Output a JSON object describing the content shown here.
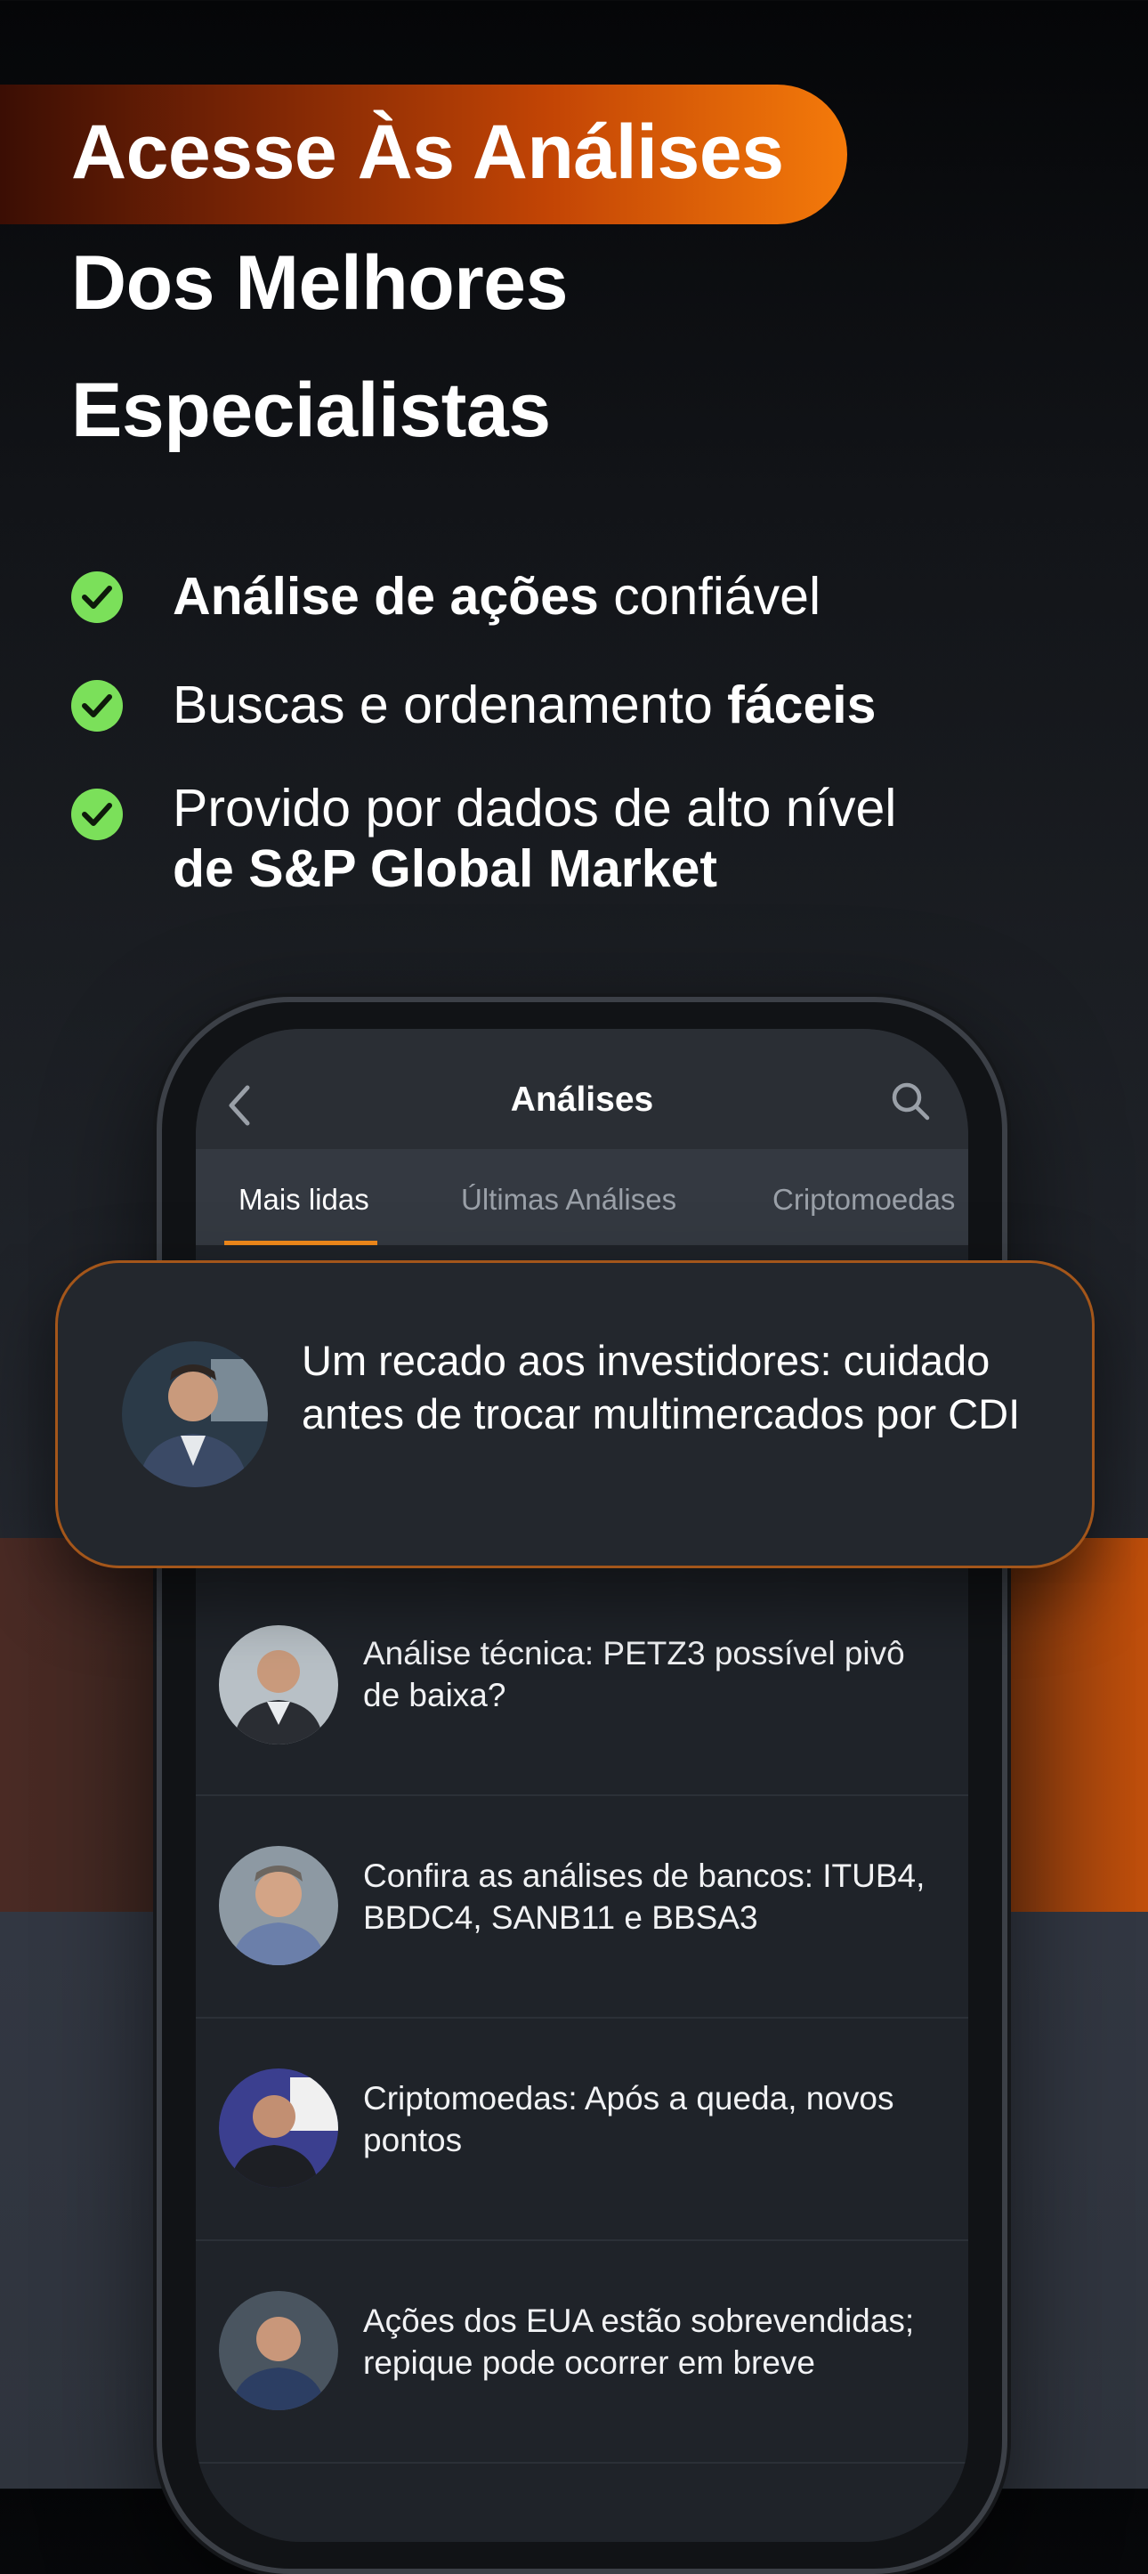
{
  "headline": {
    "line1": "Acesse Às Análises",
    "line2": "Dos Melhores",
    "line3": "Especialistas"
  },
  "features": [
    {
      "bold": "Análise de ações",
      "text": " confiável"
    },
    {
      "text": "Buscas e ordenamento ",
      "bold": "fáceis"
    },
    {
      "text": "Provido por dados de alto nível",
      "bold": "de S&P Global Market"
    }
  ],
  "app": {
    "title": "Análises",
    "tabs": [
      "Mais lidas",
      "Últimas Análises",
      "Criptomoedas"
    ],
    "featured": "Um recado aos investidores: cuidado antes de trocar multimercados por CDI",
    "items": [
      "Análise técnica: PETZ3 possível pivô de baixa?",
      "Confira as análises de bancos: ITUB4, BBDC4, SANB11 e BBSA3",
      "Criptomoedas: Após a queda, novos pontos",
      "Ações dos EUA estão sobrevendidas; repique pode ocorrer em breve"
    ]
  },
  "colors": {
    "accent_orange": "#f47a0a",
    "check_green": "#7be05a",
    "tab_underline": "#f28a1b"
  },
  "icons": [
    "check-icon",
    "back-arrow-icon",
    "search-icon",
    "avatar"
  ]
}
